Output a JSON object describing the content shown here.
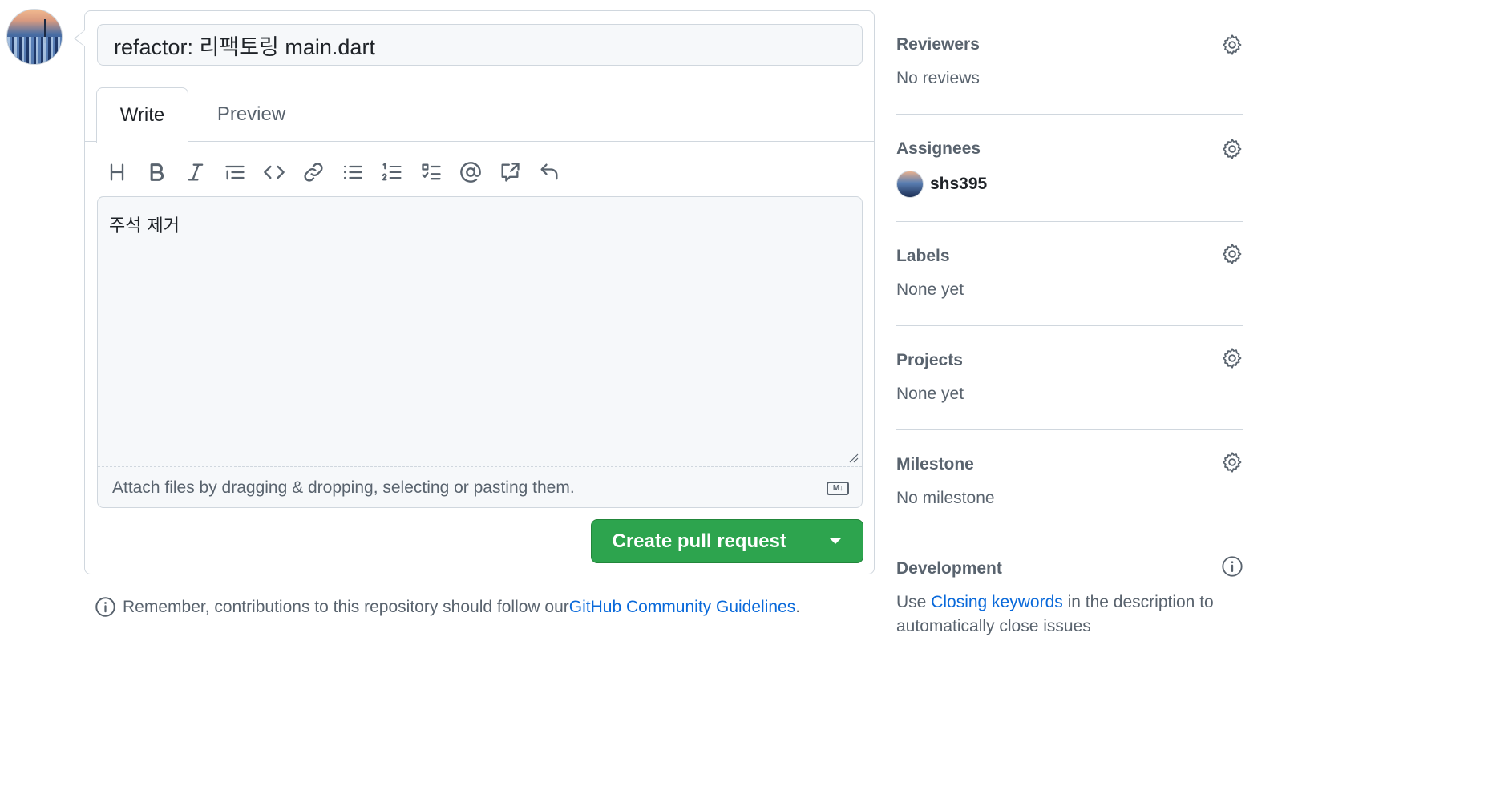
{
  "composer": {
    "title_value": "refactor: 리팩토링 main.dart",
    "tabs": [
      {
        "label": "Write"
      },
      {
        "label": "Preview"
      }
    ],
    "toolbar": [
      {
        "icon": "heading-icon"
      },
      {
        "icon": "bold-icon"
      },
      {
        "icon": "italic-icon"
      },
      {
        "icon": "quote-icon"
      },
      {
        "icon": "code-icon"
      },
      {
        "icon": "link-icon"
      },
      {
        "icon": "unordered-list-icon"
      },
      {
        "icon": "ordered-list-icon"
      },
      {
        "icon": "task-list-icon"
      },
      {
        "icon": "mention-icon"
      },
      {
        "icon": "cross-reference-icon"
      },
      {
        "icon": "saved-reply-icon"
      }
    ],
    "body_value": "주석 제거",
    "attach_hint": "Attach files by dragging & dropping, selecting or pasting them.",
    "markdown_badge": "M↓",
    "create_button": "Create pull request"
  },
  "remember": {
    "text_before": "Remember, contributions to this repository should follow our ",
    "link": "GitHub Community Guidelines",
    "text_after": "."
  },
  "sidebar": {
    "reviewers": {
      "title": "Reviewers",
      "value": "No reviews"
    },
    "assignees": {
      "title": "Assignees",
      "user": "shs395"
    },
    "labels": {
      "title": "Labels",
      "value": "None yet"
    },
    "projects": {
      "title": "Projects",
      "value": "None yet"
    },
    "milestone": {
      "title": "Milestone",
      "value": "No milestone"
    },
    "development": {
      "title": "Development",
      "text_before": "Use ",
      "link": "Closing keywords",
      "text_after": " in the description to automatically close issues"
    }
  },
  "colors": {
    "primary_button": "#2da44e",
    "link": "#0969da",
    "border": "#d0d7de",
    "muted_text": "#59636e"
  }
}
